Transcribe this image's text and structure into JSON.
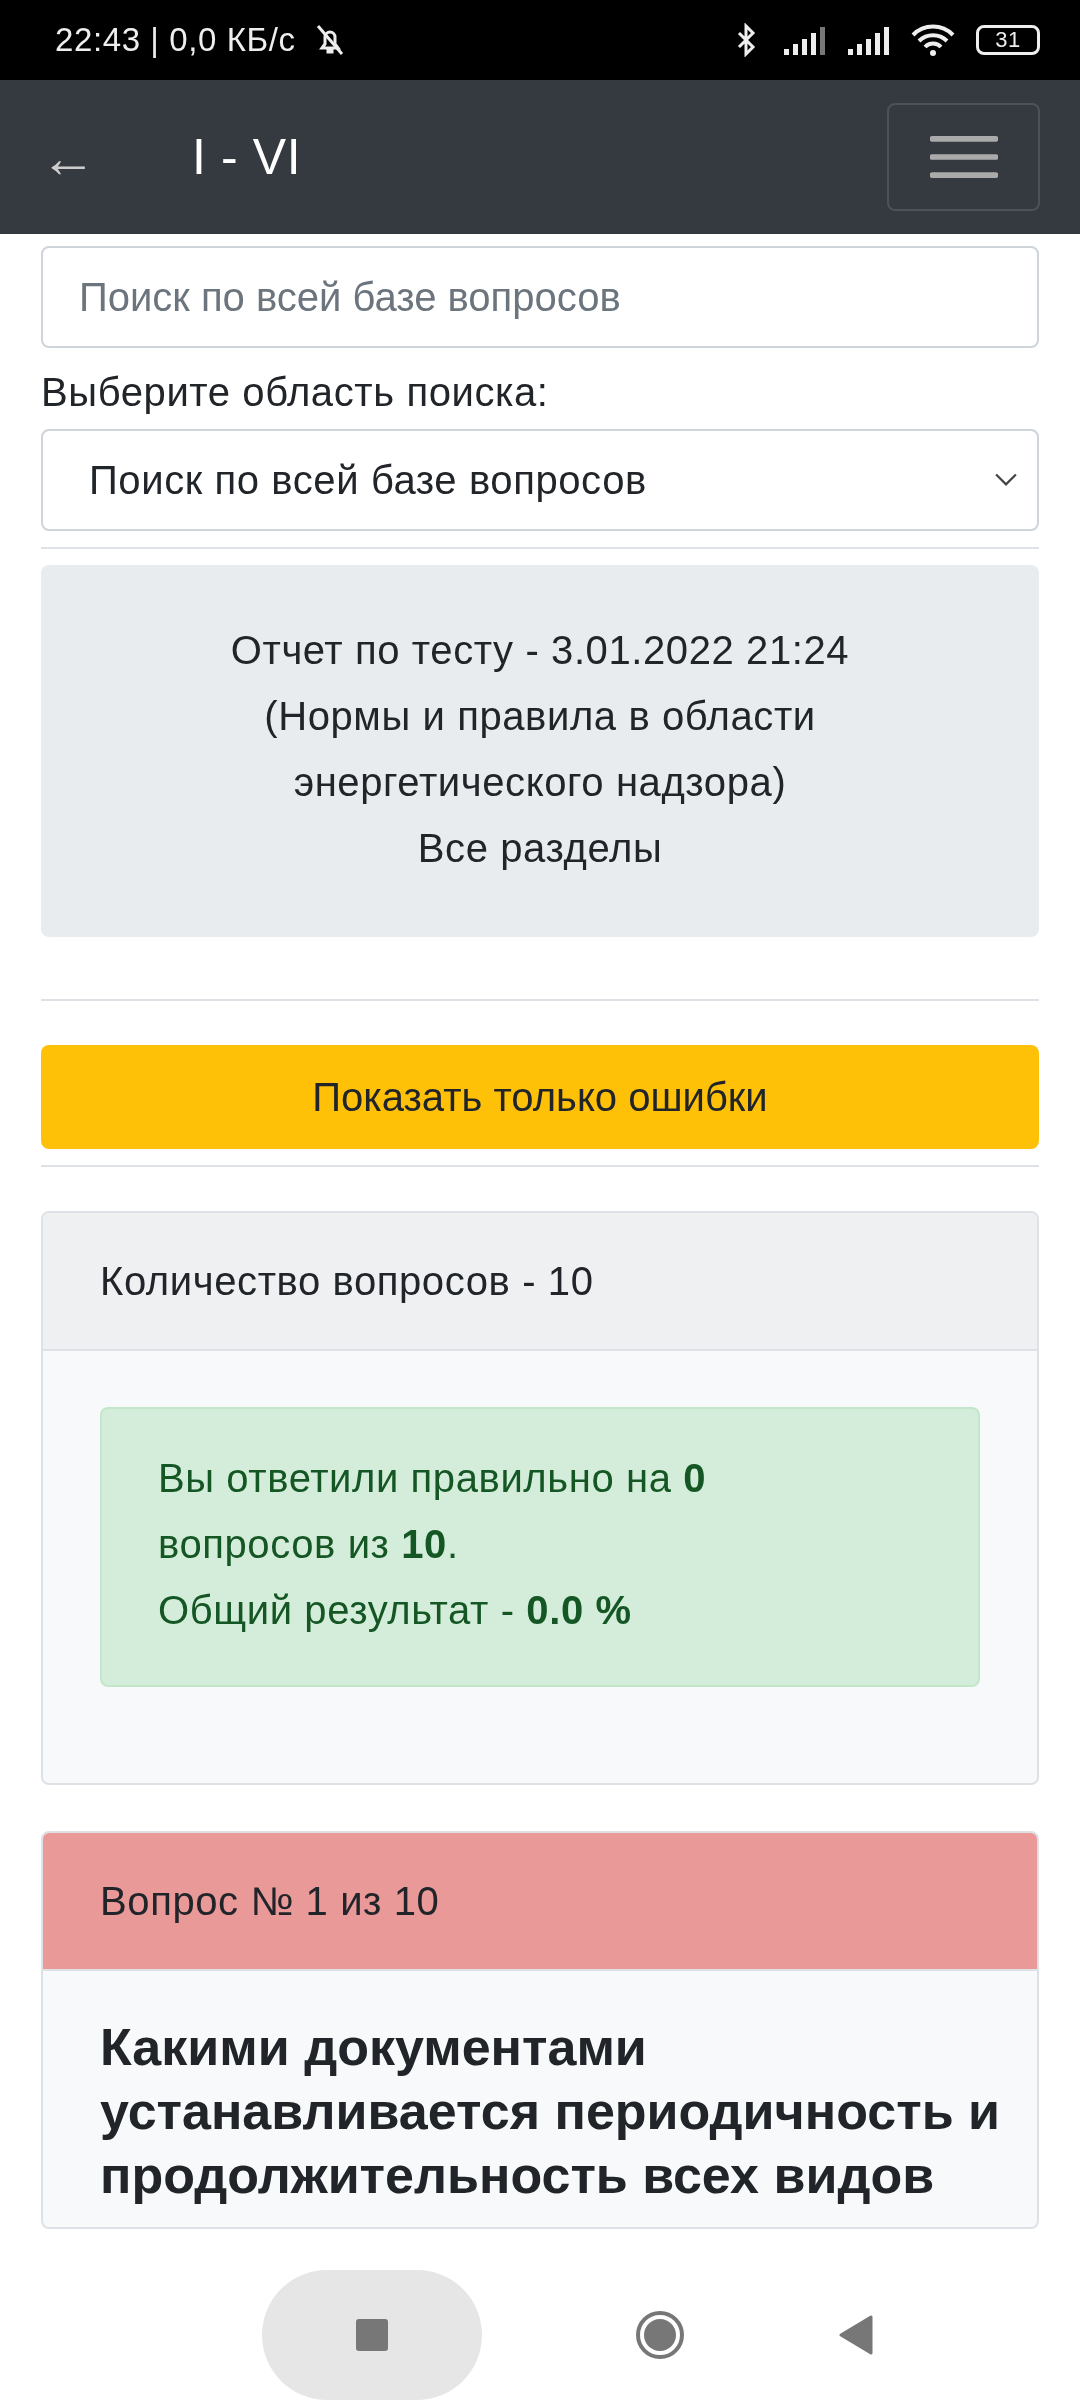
{
  "status_bar": {
    "time": "22:43 | 0,0 КБ/с",
    "battery": "31"
  },
  "header": {
    "back": "←",
    "title": "I - VI"
  },
  "search": {
    "placeholder": "Поиск по всей базе вопросов"
  },
  "scope": {
    "label": "Выберите область поиска:",
    "value": "Поиск по всей базе вопросов"
  },
  "report": {
    "lines": [
      "Отчет по тесту - 3.01.2022 21:24",
      "(Нормы и правила в области энергетического надзора)",
      "Все разделы"
    ]
  },
  "errors_button": "Показать только ошибки",
  "summary": {
    "header": "Количество вопросов - 10",
    "lines": [
      "Вы ответили правильно на **0** вопросов из **10**.",
      "Общий результат - **0.0 %**"
    ]
  },
  "question": {
    "header": "Вопрос № 1 из 10",
    "correct": false,
    "text": "Какими документами устанавливается периодичность и продолжительность всех видов"
  }
}
